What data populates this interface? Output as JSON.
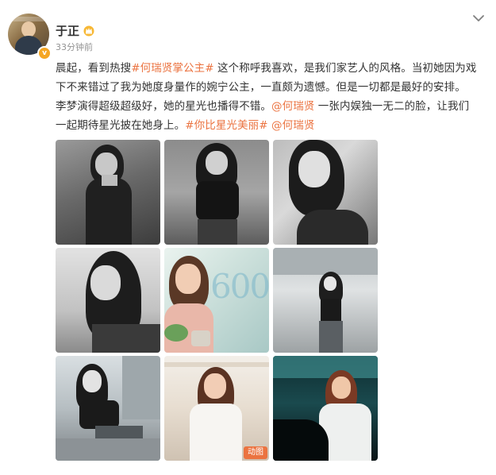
{
  "user": {
    "name": "于正",
    "verified_icon": "verified-badge-icon",
    "vip_icon": "crown-vip-icon"
  },
  "post": {
    "timestamp": "33分钟前",
    "lines": [
      [
        {
          "t": "晨起，看到热搜",
          "link": false
        },
        {
          "t": "#何瑞贤掌公主#",
          "link": true
        },
        {
          "t": " 这个称呼我喜欢，是我们家艺人的风格。当初她因为戏",
          "link": false
        }
      ],
      [
        {
          "t": "下不来错过了我为她度身量作的婉宁公主，一直颇为遗憾。但是一切都是最好的安排。",
          "link": false
        }
      ],
      [
        {
          "t": "李梦演得超级超级好，她的星光也播得不错。",
          "link": false
        },
        {
          "t": "@何瑞贤",
          "link": true
        },
        {
          "t": " 一张内娱独一无二的脸，让我们",
          "link": false
        }
      ],
      [
        {
          "t": "一起期待星光披在她身上。",
          "link": false
        },
        {
          "t": "#你比星光美丽#",
          "link": true
        },
        {
          "t": " ",
          "link": false
        },
        {
          "t": "@何瑞贤",
          "link": true
        }
      ]
    ]
  },
  "photos": {
    "overlay_text": "600",
    "gif_badge": "动图"
  },
  "colors": {
    "link": "#eb7340",
    "text": "#333333",
    "meta": "#939393"
  }
}
